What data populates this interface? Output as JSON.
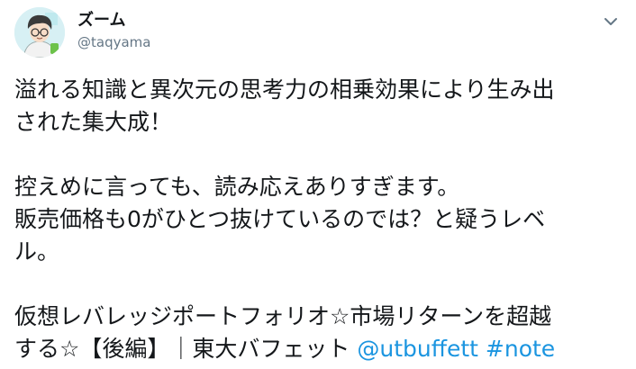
{
  "user": {
    "display_name": "ズーム",
    "handle": "@taqyama"
  },
  "icons": {
    "avatar": "avatar",
    "menu": "chevron-down-icon"
  },
  "colors": {
    "link": "#1b95e0",
    "handle": "#657786",
    "text": "#14171a",
    "avatar_bg": "#d7f0f4"
  },
  "tweet": {
    "lines": [
      "溢れる知識と異次元の思考力の相乗効果により生み出",
      "された集大成！",
      "控えめに言っても、読み応えありすぎます。",
      "販売価格も0がひとつ抜けているのでは？と疑うレベ",
      "ル。",
      "仮想レバレッジポートフォリオ☆市場リターンを超越",
      "する☆【後編】｜東大バフェット"
    ],
    "mention": "@utbuffett",
    "hashtag": "#note"
  }
}
